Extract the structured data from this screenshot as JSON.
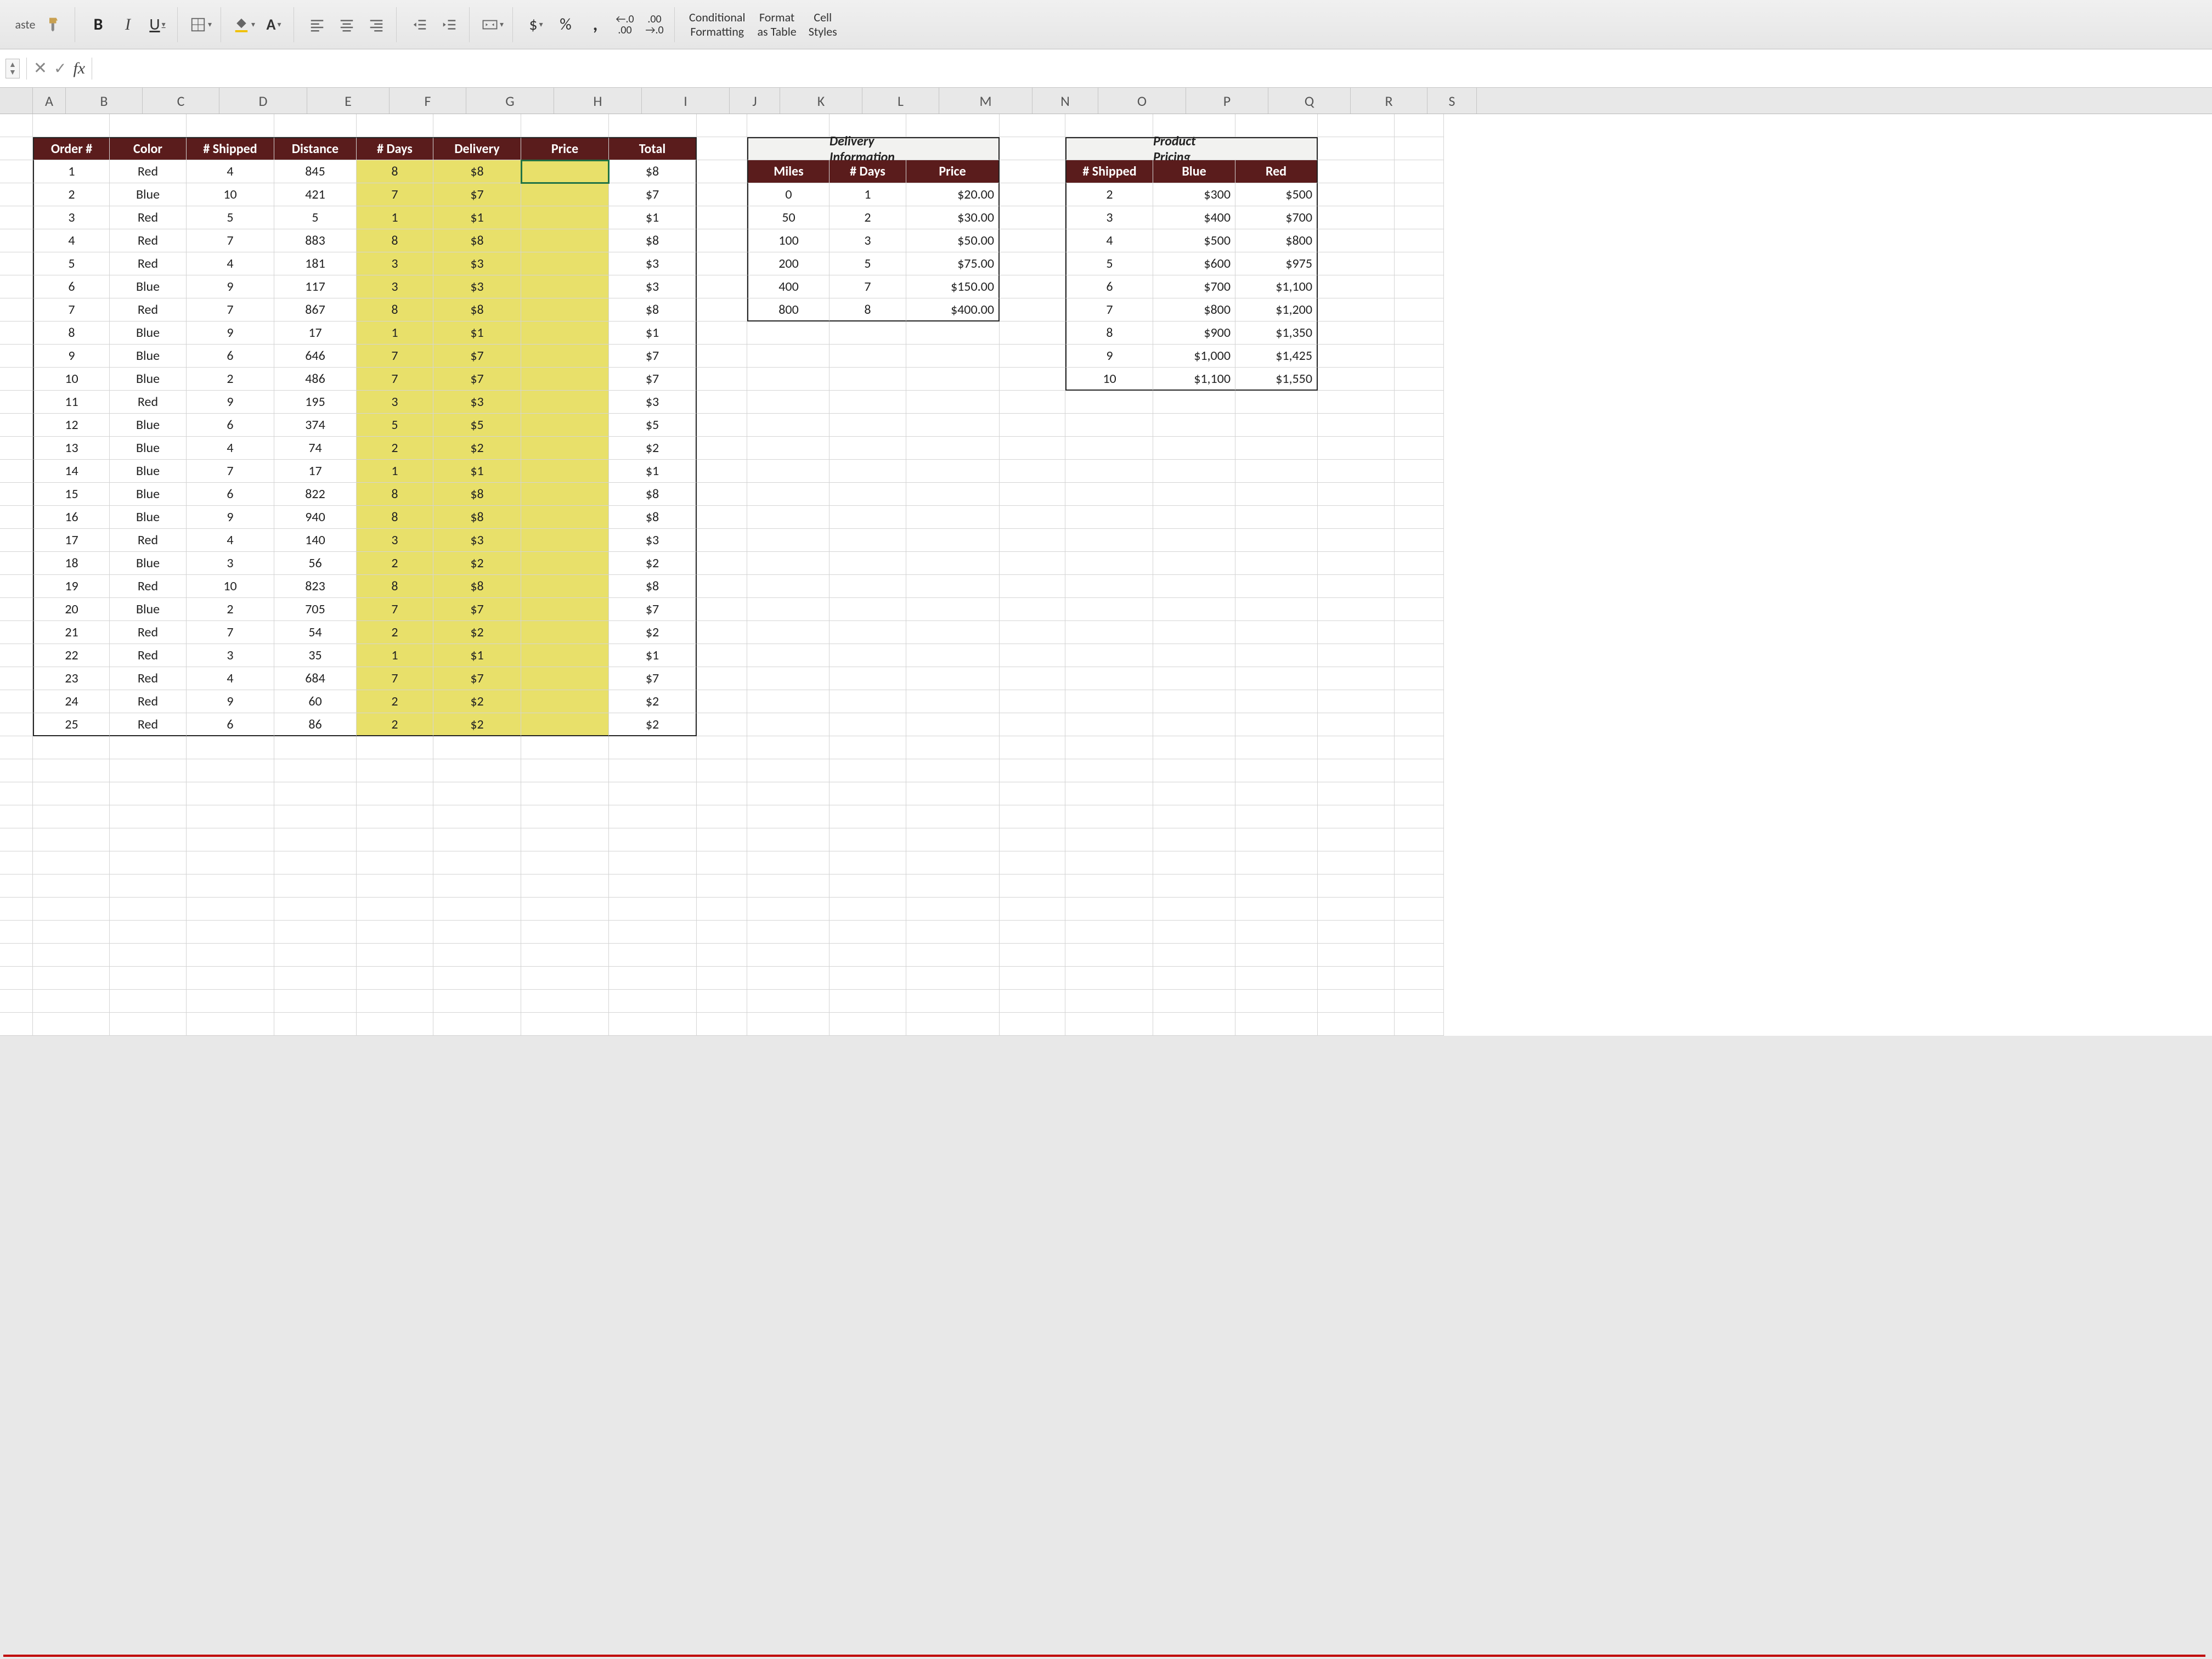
{
  "ribbon": {
    "paste": "aste",
    "bold": "B",
    "italic": "I",
    "underline": "U",
    "currency": "$",
    "percent": "%",
    "comma": ",",
    "dec_inc": ".00→.0",
    "dec_dec": "←.0 .00",
    "cond_fmt1": "Conditional",
    "cond_fmt2": "Formatting",
    "fmt_tbl1": "Format",
    "fmt_tbl2": "as Table",
    "cell1": "Cell",
    "cell2": "Styles"
  },
  "formula_bar": {
    "fx": "fx",
    "formula_value": ""
  },
  "columns": [
    "A",
    "B",
    "C",
    "D",
    "E",
    "F",
    "G",
    "H",
    "I",
    "J",
    "K",
    "L",
    "M",
    "N",
    "O",
    "P",
    "Q",
    "R",
    "S"
  ],
  "orders": {
    "headers": [
      "Order #",
      "Color",
      "# Shipped",
      "Distance",
      "# Days",
      "Delivery",
      "Price",
      "Total"
    ],
    "rows": [
      {
        "n": 1,
        "color": "Red",
        "shipped": 4,
        "dist": 845,
        "days": 8,
        "delivery": "$8",
        "price": "",
        "total": "$8"
      },
      {
        "n": 2,
        "color": "Blue",
        "shipped": 10,
        "dist": 421,
        "days": 7,
        "delivery": "$7",
        "price": "",
        "total": "$7"
      },
      {
        "n": 3,
        "color": "Red",
        "shipped": 5,
        "dist": 5,
        "days": 1,
        "delivery": "$1",
        "price": "",
        "total": "$1"
      },
      {
        "n": 4,
        "color": "Red",
        "shipped": 7,
        "dist": 883,
        "days": 8,
        "delivery": "$8",
        "price": "",
        "total": "$8"
      },
      {
        "n": 5,
        "color": "Red",
        "shipped": 4,
        "dist": 181,
        "days": 3,
        "delivery": "$3",
        "price": "",
        "total": "$3"
      },
      {
        "n": 6,
        "color": "Blue",
        "shipped": 9,
        "dist": 117,
        "days": 3,
        "delivery": "$3",
        "price": "",
        "total": "$3"
      },
      {
        "n": 7,
        "color": "Red",
        "shipped": 7,
        "dist": 867,
        "days": 8,
        "delivery": "$8",
        "price": "",
        "total": "$8"
      },
      {
        "n": 8,
        "color": "Blue",
        "shipped": 9,
        "dist": 17,
        "days": 1,
        "delivery": "$1",
        "price": "",
        "total": "$1"
      },
      {
        "n": 9,
        "color": "Blue",
        "shipped": 6,
        "dist": 646,
        "days": 7,
        "delivery": "$7",
        "price": "",
        "total": "$7"
      },
      {
        "n": 10,
        "color": "Blue",
        "shipped": 2,
        "dist": 486,
        "days": 7,
        "delivery": "$7",
        "price": "",
        "total": "$7"
      },
      {
        "n": 11,
        "color": "Red",
        "shipped": 9,
        "dist": 195,
        "days": 3,
        "delivery": "$3",
        "price": "",
        "total": "$3"
      },
      {
        "n": 12,
        "color": "Blue",
        "shipped": 6,
        "dist": 374,
        "days": 5,
        "delivery": "$5",
        "price": "",
        "total": "$5"
      },
      {
        "n": 13,
        "color": "Blue",
        "shipped": 4,
        "dist": 74,
        "days": 2,
        "delivery": "$2",
        "price": "",
        "total": "$2"
      },
      {
        "n": 14,
        "color": "Blue",
        "shipped": 7,
        "dist": 17,
        "days": 1,
        "delivery": "$1",
        "price": "",
        "total": "$1"
      },
      {
        "n": 15,
        "color": "Blue",
        "shipped": 6,
        "dist": 822,
        "days": 8,
        "delivery": "$8",
        "price": "",
        "total": "$8"
      },
      {
        "n": 16,
        "color": "Blue",
        "shipped": 9,
        "dist": 940,
        "days": 8,
        "delivery": "$8",
        "price": "",
        "total": "$8"
      },
      {
        "n": 17,
        "color": "Red",
        "shipped": 4,
        "dist": 140,
        "days": 3,
        "delivery": "$3",
        "price": "",
        "total": "$3"
      },
      {
        "n": 18,
        "color": "Blue",
        "shipped": 3,
        "dist": 56,
        "days": 2,
        "delivery": "$2",
        "price": "",
        "total": "$2"
      },
      {
        "n": 19,
        "color": "Red",
        "shipped": 10,
        "dist": 823,
        "days": 8,
        "delivery": "$8",
        "price": "",
        "total": "$8"
      },
      {
        "n": 20,
        "color": "Blue",
        "shipped": 2,
        "dist": 705,
        "days": 7,
        "delivery": "$7",
        "price": "",
        "total": "$7"
      },
      {
        "n": 21,
        "color": "Red",
        "shipped": 7,
        "dist": 54,
        "days": 2,
        "delivery": "$2",
        "price": "",
        "total": "$2"
      },
      {
        "n": 22,
        "color": "Red",
        "shipped": 3,
        "dist": 35,
        "days": 1,
        "delivery": "$1",
        "price": "",
        "total": "$1"
      },
      {
        "n": 23,
        "color": "Red",
        "shipped": 4,
        "dist": 684,
        "days": 7,
        "delivery": "$7",
        "price": "",
        "total": "$7"
      },
      {
        "n": 24,
        "color": "Red",
        "shipped": 9,
        "dist": 60,
        "days": 2,
        "delivery": "$2",
        "price": "",
        "total": "$2"
      },
      {
        "n": 25,
        "color": "Red",
        "shipped": 6,
        "dist": 86,
        "days": 2,
        "delivery": "$2",
        "price": "",
        "total": "$2"
      }
    ]
  },
  "delivery": {
    "title": "Delivery Information",
    "headers": [
      "Miles",
      "# Days",
      "Price"
    ],
    "rows": [
      {
        "miles": 0,
        "days": 1,
        "price": "$20.00"
      },
      {
        "miles": 50,
        "days": 2,
        "price": "$30.00"
      },
      {
        "miles": 100,
        "days": 3,
        "price": "$50.00"
      },
      {
        "miles": 200,
        "days": 5,
        "price": "$75.00"
      },
      {
        "miles": 400,
        "days": 7,
        "price": "$150.00"
      },
      {
        "miles": 800,
        "days": 8,
        "price": "$400.00"
      }
    ]
  },
  "pricing": {
    "title": "Product Pricing",
    "headers": [
      "# Shipped",
      "Blue",
      "Red"
    ],
    "rows": [
      {
        "shipped": 2,
        "blue": "$300",
        "red": "$500"
      },
      {
        "shipped": 3,
        "blue": "$400",
        "red": "$700"
      },
      {
        "shipped": 4,
        "blue": "$500",
        "red": "$800"
      },
      {
        "shipped": 5,
        "blue": "$600",
        "red": "$975"
      },
      {
        "shipped": 6,
        "blue": "$700",
        "red": "$1,100"
      },
      {
        "shipped": 7,
        "blue": "$800",
        "red": "$1,200"
      },
      {
        "shipped": 8,
        "blue": "$900",
        "red": "$1,350"
      },
      {
        "shipped": 9,
        "blue": "$1,000",
        "red": "$1,425"
      },
      {
        "shipped": 10,
        "blue": "$1,100",
        "red": "$1,550"
      }
    ]
  },
  "selected_cell": "H3",
  "colors": {
    "header_bg": "#5a1c1c",
    "highlight": "#e8e06a",
    "selection": "#217346"
  }
}
